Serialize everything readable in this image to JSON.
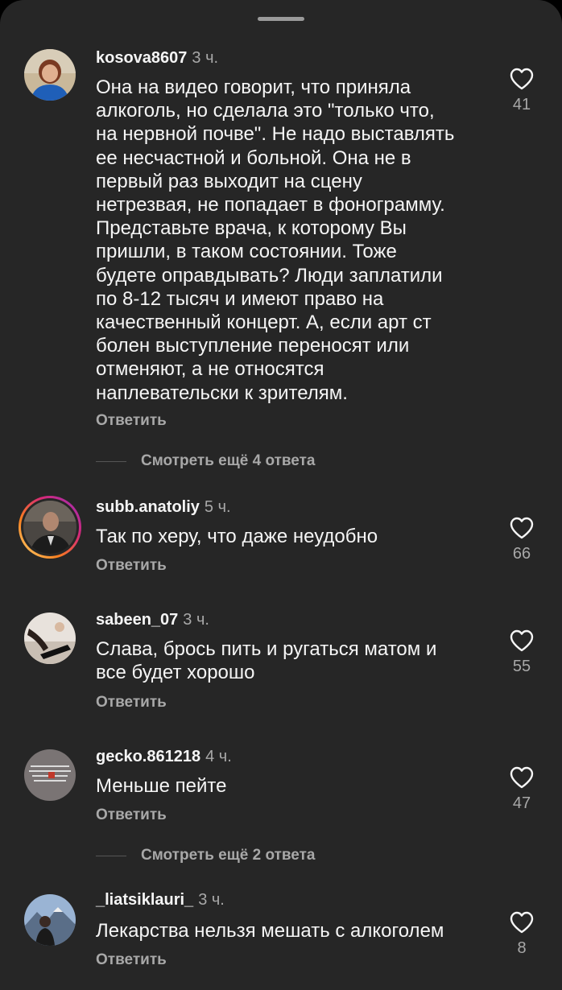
{
  "comments": [
    {
      "username": "kosova8607",
      "time": "3 ч.",
      "lines": [
        "Она на видео говорит, что приняла",
        "алкоголь, но сделала это \"только что,",
        "на нервной почве\". Не надо выставлять",
        "ее несчастной и больной. Она не в",
        "первый раз выходит на сцену",
        "нетрезвая, не попадает в фонограмму.",
        "Представьте врача, к которому Вы",
        "пришли, в таком состоянии. Тоже",
        "будете оправдывать? Люди заплатили",
        "по 8-12 тысяч и имеют право на",
        "качественный концерт. А, если арт ст",
        "болен выступление переносят или",
        "отменяют, а не относятся",
        "наплевательски к зрителям."
      ],
      "reply_label": "Ответить",
      "likes": "41"
    },
    {
      "username": "subb.anatoliy",
      "time": "5 ч.",
      "lines": [
        "Так по херу, что даже неудобно"
      ],
      "reply_label": "Ответить",
      "likes": "66"
    },
    {
      "username": "sabeen_07",
      "time": "3 ч.",
      "lines": [
        "Слава, брось пить и ругаться матом и",
        "все будет хорошо"
      ],
      "reply_label": "Ответить",
      "likes": "55"
    },
    {
      "username": "gecko.861218",
      "time": "4 ч.",
      "lines": [
        "Меньше пейте"
      ],
      "reply_label": "Ответить",
      "likes": "47"
    },
    {
      "username": "_liatsiklauri_",
      "time": "3 ч.",
      "lines": [
        "Лекарства нельзя мешать с алкоголем"
      ],
      "reply_label": "Ответить",
      "likes": "8"
    }
  ],
  "view_more_1": "Смотреть ещё 4 ответа",
  "view_more_2": "Смотреть ещё 2 ответа",
  "icons": {
    "like": "heart-outline-icon",
    "grabber": "sheet-grabber-handle"
  },
  "colors": {
    "background": "#262626",
    "text": "#f5f5f5",
    "secondary": "#a8a8a8"
  }
}
